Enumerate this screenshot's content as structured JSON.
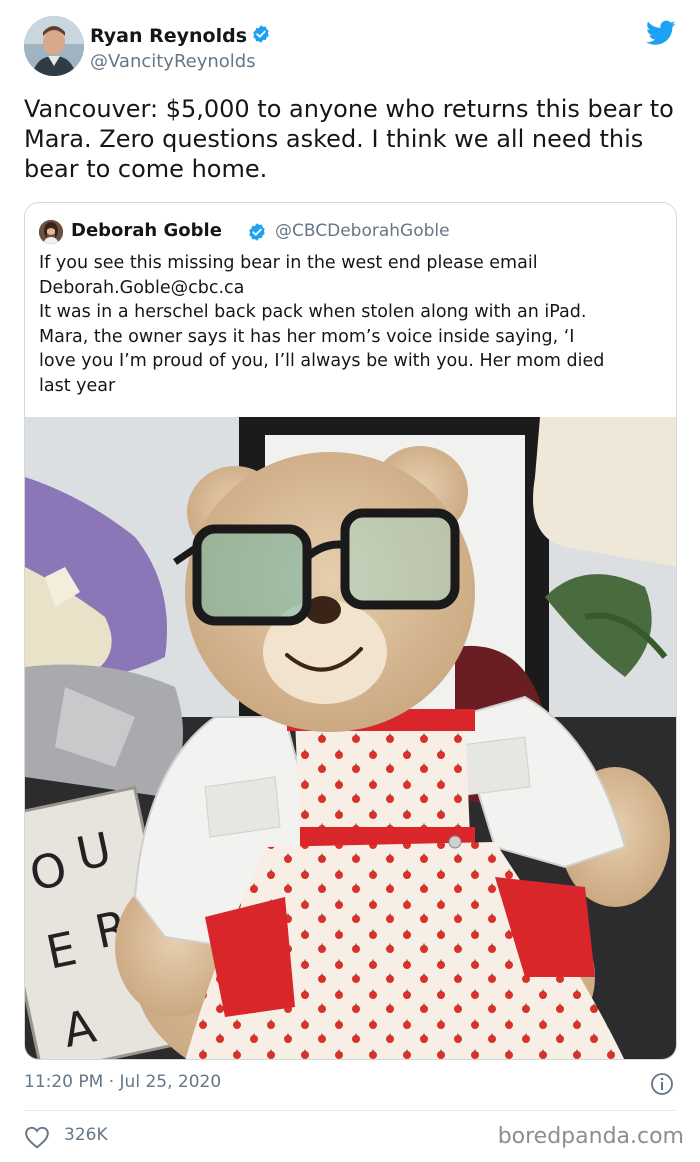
{
  "author": {
    "display_name": "Ryan Reynolds",
    "handle": "@VancityReynolds"
  },
  "tweet": {
    "text": "Vancouver: $5,000 to anyone who returns this bear to Mara. Zero questions asked. I think we all need this bear to come home."
  },
  "quoted": {
    "display_name": "Deborah Goble",
    "handle": "@CBCDeborahGoble",
    "lines": [
      "If you see this missing bear in the west end please email",
      "Deborah.Goble@cbc.ca",
      "It was in a herschel back pack when stolen along with an iPad.",
      "Mara, the owner says it has her mom’s voice inside saying, ‘I",
      "love you I’m proud of you, I’ll always be with you. Her mom died",
      "last year"
    ],
    "photo_letters": [
      "O",
      "U",
      "E",
      "R",
      "A"
    ]
  },
  "meta": {
    "timestamp": "11:20 PM · Jul 25, 2020",
    "likes": "326K",
    "watermark": "boredpanda.com"
  },
  "colors": {
    "twitter_blue": "#1da1f2",
    "text_primary": "#14171a",
    "text_secondary": "#657786"
  },
  "icons": [
    "verified-badge-icon",
    "twitter-bird-icon",
    "info-icon",
    "heart-icon"
  ]
}
